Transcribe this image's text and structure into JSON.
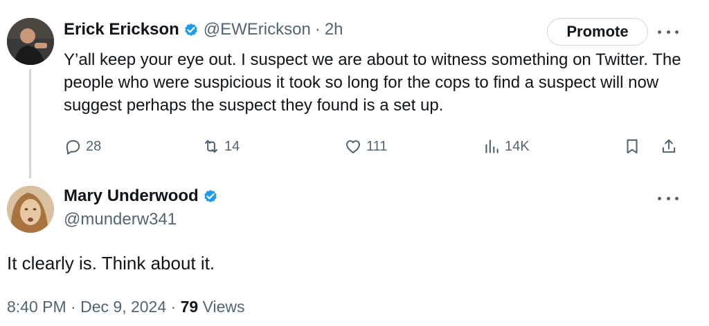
{
  "tweet1": {
    "display_name": "Erick Erickson",
    "handle": "@EWErickson",
    "separator": "·",
    "time": "2h",
    "promote_label": "Promote",
    "body": "Y’all keep your eye out. I suspect we are about to witness something on Twitter. The people who were suspicious it took so long for the cops to find a suspect will now suggest perhaps the suspect they found is a set up.",
    "actions": {
      "replies": "28",
      "reposts": "14",
      "likes": "111",
      "views": "14K"
    }
  },
  "tweet2": {
    "display_name": "Mary Underwood",
    "handle": "@munderw341",
    "body": "It clearly is. Think about it.",
    "time": "8:40 PM",
    "separator": "·",
    "date": "Dec 9, 2024",
    "separator2": "·",
    "views_count": "79",
    "views_label": "Views"
  },
  "colors": {
    "verified": "#1d9bf0",
    "secondary_text": "#536471",
    "primary_text": "#0f1419",
    "thread_line": "#cfd9de"
  }
}
